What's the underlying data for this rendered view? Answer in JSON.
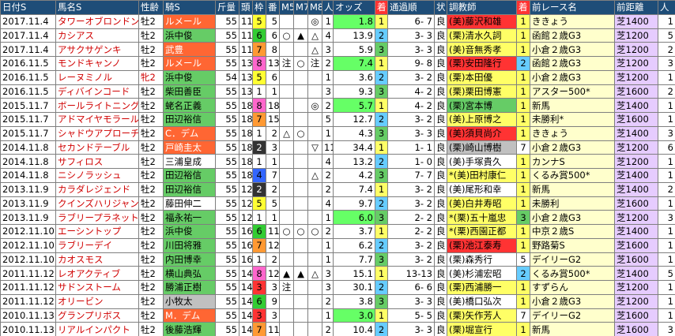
{
  "headers": [
    "日付S",
    "馬名S",
    "性齢",
    "騎S",
    "斤量",
    "頭",
    "枠",
    "番",
    "M5",
    "M7",
    "M8",
    "人",
    "オッズ",
    "着",
    "通過順",
    "状",
    "調教師",
    "着",
    "前レース名",
    "前距離",
    "人"
  ],
  "rows": [
    {
      "date": "2017.11.4",
      "horse": "タワーオブロンドン",
      "age": "牡2",
      "jockey": "ルメール",
      "jc": "j-red",
      "wt": "55",
      "n": "11",
      "waku": "5",
      "ban": "5",
      "m5": "",
      "m7": "",
      "m8": "◎",
      "pop": "1",
      "odds": "1.8",
      "oc": "odds-cell",
      "rank": "1",
      "pass": "6- 7",
      "cond": "良",
      "trainer": "(美)藤沢和雄",
      "tc": "t-red",
      "prank": "1",
      "prace": "ききょう",
      "pdist": "芝1400",
      "ppop": "1"
    },
    {
      "date": "2017.11.4",
      "horse": "カシアス",
      "age": "牡2",
      "jockey": "浜中俊",
      "jc": "j-green",
      "wt": "55",
      "n": "11",
      "waku": "6",
      "ban": "6",
      "m5": "○",
      "m7": "▲",
      "m8": "△",
      "pop": "4",
      "odds": "13.9",
      "oc": "odds-plain",
      "rank": "2",
      "pass": "3- 3",
      "cond": "良",
      "trainer": "(栗)清水久詞",
      "tc": "t-yellow",
      "prank": "1",
      "prace": "函館２歳G3",
      "pdist": "芝1200",
      "ppop": "5"
    },
    {
      "date": "2017.11.4",
      "horse": "アサクサゲンキ",
      "age": "牡2",
      "jockey": "武豊",
      "jc": "j-red",
      "wt": "55",
      "n": "11",
      "waku": "7",
      "ban": "8",
      "m5": "",
      "m7": "",
      "m8": "△",
      "pop": "3",
      "odds": "5.9",
      "oc": "odds-plain",
      "rank": "3",
      "pass": "3- 3",
      "cond": "良",
      "trainer": "(美)音無秀孝",
      "tc": "t-yellow",
      "prank": "1",
      "prace": "小倉２歳G3",
      "pdist": "芝1200",
      "ppop": "2"
    },
    {
      "date": "2016.11.5",
      "horse": "モンドキャンノ",
      "age": "牡2",
      "jockey": "ルメール",
      "jc": "j-red",
      "wt": "55",
      "n": "13",
      "waku": "8",
      "ban": "13",
      "m5": "注",
      "m7": "○",
      "m8": "注",
      "pop": "2",
      "odds": "7.4",
      "oc": "odds-cell",
      "rank": "1",
      "pass": "9- 8",
      "cond": "良",
      "trainer": "(栗)安田隆行",
      "tc": "t-red",
      "prank": "2",
      "prace": "函館２歳G3",
      "pdist": "芝1200",
      "ppop": "3"
    },
    {
      "date": "2016.11.5",
      "horse": "レーヌミノル",
      "age": "牝2",
      "agef": "1",
      "jockey": "浜中俊",
      "jc": "j-green",
      "wt": "54",
      "n": "13",
      "waku": "5",
      "ban": "6",
      "m5": "",
      "m7": "",
      "m8": "",
      "pop": "1",
      "odds": "3.6",
      "oc": "odds-plain",
      "rank": "2",
      "pass": "3- 2",
      "cond": "良",
      "trainer": "(栗)本田優",
      "tc": "t-yellow",
      "prank": "1",
      "prace": "小倉２歳G3",
      "pdist": "芝1200",
      "ppop": "1"
    },
    {
      "date": "2016.11.5",
      "horse": "ディバインコード",
      "age": "牡2",
      "jockey": "柴田善臣",
      "jc": "j-green",
      "wt": "55",
      "n": "13",
      "waku": "1",
      "ban": "1",
      "m5": "",
      "m7": "",
      "m8": "",
      "pop": "3",
      "odds": "9.3",
      "oc": "odds-plain",
      "rank": "3",
      "pass": "4- 2",
      "cond": "良",
      "trainer": "(栗)栗田博憲",
      "tc": "t-yellow",
      "prank": "1",
      "prace": "アスター500*",
      "pdist": "芝1600",
      "ppop": "2"
    },
    {
      "date": "2015.11.7",
      "horse": "ボールライトニング",
      "age": "牡2",
      "jockey": "蛯名正義",
      "jc": "j-green",
      "wt": "55",
      "n": "18",
      "waku": "8",
      "ban": "18",
      "m5": "",
      "m7": "",
      "m8": "◎",
      "pop": "2",
      "odds": "5.7",
      "oc": "odds-cell",
      "rank": "1",
      "pass": "4- 2",
      "cond": "良",
      "trainer": "(栗)宮本博",
      "tc": "t-green",
      "prank": "1",
      "prace": "新馬",
      "pdist": "芝1400",
      "ppop": "1"
    },
    {
      "date": "2015.11.7",
      "horse": "アドマイヤモラール",
      "age": "牡2",
      "jockey": "田辺裕信",
      "jc": "j-green",
      "wt": "55",
      "n": "18",
      "waku": "7",
      "ban": "15",
      "m5": "",
      "m7": "",
      "m8": "",
      "pop": "5",
      "odds": "12.7",
      "oc": "odds-plain",
      "rank": "2",
      "pass": "3- 2",
      "cond": "良",
      "trainer": "(美)上原博之",
      "tc": "t-yellow",
      "prank": "1",
      "prace": "未勝利*",
      "pdist": "芝1600",
      "ppop": "1"
    },
    {
      "date": "2015.11.7",
      "horse": "シャドウアプローチ",
      "age": "牡2",
      "jockey": "C．デム",
      "jc": "j-red",
      "wt": "55",
      "n": "18",
      "waku": "1",
      "ban": "2",
      "m5": "△",
      "m7": "○",
      "m8": "",
      "pop": "1",
      "odds": "4.3",
      "oc": "odds-plain",
      "rank": "3",
      "pass": "3- 3",
      "cond": "良",
      "trainer": "(美)須貝尚介",
      "tc": "t-red",
      "prank": "1",
      "prace": "ききょう",
      "pdist": "芝1400",
      "ppop": "3"
    },
    {
      "date": "2014.11.8",
      "horse": "セカンドテーブル",
      "age": "牡2",
      "jockey": "戸崎圭太",
      "jc": "j-red",
      "wt": "55",
      "n": "18",
      "waku": "2",
      "ban": "3",
      "m5": "",
      "m7": "",
      "m8": "▽",
      "pop": "11",
      "odds": "34.4",
      "oc": "odds-plain",
      "rank": "1",
      "pass": "1- 1",
      "cond": "良",
      "trainer": "(栗)崎山博樹",
      "tc": "t-gray",
      "prank": "7",
      "prace": "小倉２歳G3",
      "pdist": "芝1200",
      "ppop": "6"
    },
    {
      "date": "2014.11.8",
      "horse": "サフィロス",
      "age": "牡2",
      "jockey": "三浦皇成",
      "jc": "j-none",
      "wt": "55",
      "n": "18",
      "waku": "1",
      "ban": "1",
      "m5": "",
      "m7": "",
      "m8": "",
      "pop": "4",
      "odds": "13.2",
      "oc": "odds-plain",
      "rank": "2",
      "pass": "1- 0",
      "cond": "良",
      "trainer": "(美)手塚貴久",
      "tc": "t-none",
      "prank": "1",
      "prace": "カンナS",
      "pdist": "芝1200",
      "ppop": "1"
    },
    {
      "date": "2014.11.8",
      "horse": "ニシノラッシュ",
      "age": "牡2",
      "jockey": "田辺裕信",
      "jc": "j-green",
      "wt": "55",
      "n": "18",
      "waku": "4",
      "ban": "7",
      "m5": "",
      "m7": "",
      "m8": "△",
      "pop": "2",
      "odds": "4.2",
      "oc": "odds-plain",
      "rank": "3",
      "pass": "7- 7",
      "cond": "良",
      "trainer": "*(美)田村康仁",
      "tc": "t-yellow",
      "prank": "1",
      "prace": "くるみ賞500*",
      "pdist": "芝1400",
      "ppop": "1"
    },
    {
      "date": "2013.11.9",
      "horse": "カラダレジェンド",
      "age": "牡2",
      "jockey": "田辺裕信",
      "jc": "j-green",
      "wt": "55",
      "n": "12",
      "waku": "2",
      "ban": "2",
      "m5": "",
      "m7": "",
      "m8": "",
      "pop": "2",
      "odds": "7.4",
      "oc": "odds-plain",
      "rank": "1",
      "pass": "3- 2",
      "cond": "良",
      "trainer": "(美)尾形和幸",
      "tc": "t-none",
      "prank": "1",
      "prace": "新馬",
      "pdist": "芝1400",
      "ppop": "2"
    },
    {
      "date": "2013.11.9",
      "horse": "クインズハリジャン",
      "age": "牡2",
      "jockey": "藤田伸二",
      "jc": "j-none",
      "wt": "55",
      "n": "12",
      "waku": "5",
      "ban": "5",
      "m5": "",
      "m7": "",
      "m8": "",
      "pop": "4",
      "odds": "9.7",
      "oc": "odds-plain",
      "rank": "2",
      "pass": "3- 2",
      "cond": "良",
      "trainer": "(美)白井寿昭",
      "tc": "t-yellow",
      "prank": "1",
      "prace": "未勝利",
      "pdist": "芝1600",
      "ppop": "1"
    },
    {
      "date": "2013.11.9",
      "horse": "ラブリープラネット",
      "age": "牡2",
      "jockey": "福永祐一",
      "jc": "j-green",
      "wt": "55",
      "n": "12",
      "waku": "1",
      "ban": "1",
      "m5": "",
      "m7": "",
      "m8": "",
      "pop": "1",
      "odds": "6.0",
      "oc": "odds-cell",
      "rank": "3",
      "pass": "2- 2",
      "cond": "良",
      "trainer": "*(栗)五十嵐忠",
      "tc": "t-yellow",
      "prank": "3",
      "prace": "小倉２歳G3",
      "pdist": "芝1200",
      "ppop": "3"
    },
    {
      "date": "2012.11.10",
      "horse": "エーシントップ",
      "age": "牡2",
      "jockey": "浜中俊",
      "jc": "j-green",
      "wt": "55",
      "n": "16",
      "waku": "6",
      "ban": "11",
      "m5": "○",
      "m7": "○",
      "m8": "○",
      "pop": "2",
      "odds": "3.7",
      "oc": "odds-plain",
      "rank": "1",
      "pass": "2- 2",
      "cond": "良",
      "trainer": "*(栗)西園正都",
      "tc": "t-yellow",
      "prank": "1",
      "prace": "中京２歳S",
      "pdist": "芝1400",
      "ppop": "1"
    },
    {
      "date": "2012.11.10",
      "horse": "ラブリーデイ",
      "age": "牡2",
      "jockey": "川田将雅",
      "jc": "j-green",
      "wt": "55",
      "n": "16",
      "waku": "7",
      "ban": "12",
      "m5": "",
      "m7": "",
      "m8": "",
      "pop": "1",
      "odds": "6.2",
      "oc": "odds-plain",
      "rank": "2",
      "pass": "3- 2",
      "cond": "良",
      "trainer": "(栗)池江泰寿",
      "tc": "t-red",
      "prank": "1",
      "prace": "野路菊S",
      "pdist": "芝1600",
      "ppop": "1"
    },
    {
      "date": "2012.11.10",
      "horse": "カオスモス",
      "age": "牡2",
      "jockey": "内田博幸",
      "jc": "j-green",
      "wt": "55",
      "n": "16",
      "waku": "1",
      "ban": "2",
      "m5": "",
      "m7": "",
      "m8": "",
      "pop": "1",
      "odds": "7.7",
      "oc": "odds-plain",
      "rank": "3",
      "pass": "3- 2",
      "cond": "良",
      "trainer": "(栗)森秀行",
      "tc": "t-none",
      "prank": "5",
      "prace": "デイリーG2",
      "pdist": "芝1600",
      "ppop": "1"
    },
    {
      "date": "2011.11.12",
      "horse": "レオアクティブ",
      "age": "牡2",
      "jockey": "横山典弘",
      "jc": "j-green",
      "wt": "55",
      "n": "14",
      "waku": "8",
      "ban": "12",
      "m5": "▲",
      "m7": "▲",
      "m8": "△",
      "pop": "3",
      "odds": "15.1",
      "oc": "odds-plain",
      "rank": "1",
      "pass": "13-13",
      "cond": "良",
      "trainer": "(美)杉浦宏昭",
      "tc": "t-none",
      "prank": "2",
      "prace": "くるみ賞500*",
      "pdist": "芝1400",
      "ppop": "5"
    },
    {
      "date": "2011.11.12",
      "horse": "サドンストーム",
      "age": "牡2",
      "jockey": "勝浦正樹",
      "jc": "j-green",
      "wt": "55",
      "n": "14",
      "waku": "3",
      "ban": "3",
      "m5": "注",
      "m7": "",
      "m8": "",
      "pop": "3",
      "odds": "30.1",
      "oc": "odds-plain",
      "rank": "2",
      "pass": "6- 6",
      "cond": "良",
      "trainer": "(栗)西浦勝一",
      "tc": "t-yellow",
      "prank": "1",
      "prace": "すずらん",
      "pdist": "芝1200",
      "ppop": "1"
    },
    {
      "date": "2011.11.12",
      "horse": "オリービン",
      "age": "牡2",
      "jockey": "小牧太",
      "jc": "j-gray",
      "wt": "55",
      "n": "14",
      "waku": "6",
      "ban": "9",
      "m5": "",
      "m7": "",
      "m8": "",
      "pop": "2",
      "odds": "3.8",
      "oc": "odds-plain",
      "rank": "3",
      "pass": "3- 3",
      "cond": "良",
      "trainer": "(美)橋口弘次",
      "tc": "t-none",
      "prank": "1",
      "prace": "小倉２歳G3",
      "pdist": "芝1200",
      "ppop": "1"
    },
    {
      "date": "2010.11.13",
      "horse": "グランプリボス",
      "age": "牡2",
      "jockey": "M．デム",
      "jc": "j-red",
      "wt": "55",
      "n": "14",
      "waku": "3",
      "ban": "3",
      "m5": "",
      "m7": "",
      "m8": "",
      "pop": "1",
      "odds": "3.0",
      "oc": "odds-cell",
      "rank": "1",
      "pass": "5- 5",
      "cond": "良",
      "trainer": "(栗)矢作芳人",
      "tc": "t-yellow",
      "prank": "7",
      "prace": "デイリーG2",
      "pdist": "芝1600",
      "ppop": "1"
    },
    {
      "date": "2010.11.13",
      "horse": "リアルインパクト",
      "age": "牡2",
      "jockey": "後藤浩輝",
      "jc": "j-green",
      "wt": "55",
      "n": "14",
      "waku": "7",
      "ban": "11",
      "m5": "",
      "m7": "",
      "m8": "",
      "pop": "2",
      "odds": "10.4",
      "oc": "odds-plain",
      "rank": "2",
      "pass": "3- 3",
      "cond": "良",
      "trainer": "(栗)堀宣行",
      "tc": "t-yellow",
      "prank": "1",
      "prace": "新馬",
      "pdist": "芝1600",
      "ppop": "3"
    },
    {
      "date": "2010.11.13",
      "horse": "テイエムオオタカ",
      "age": "牡2",
      "jockey": "大庭和弥",
      "jc": "j-green",
      "wt": "55",
      "n": "14",
      "waku": "1",
      "ban": "2",
      "m5": "",
      "m7": "",
      "m8": "",
      "pop": "10",
      "odds": "140.0",
      "oc": "odds-plain",
      "rank": "3",
      "pass": "1- 1",
      "cond": "良",
      "trainer": "(美)石栗龍彦",
      "tc": "t-yellow",
      "prank": "1",
      "prace": "未勝利*",
      "pdist": "芝1400",
      "ppop": "1"
    }
  ]
}
